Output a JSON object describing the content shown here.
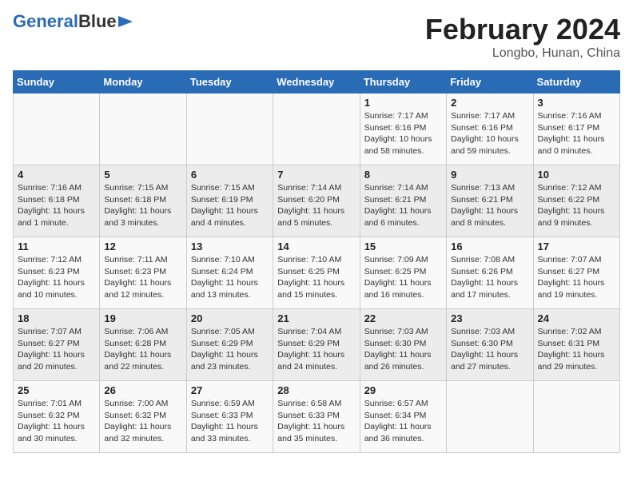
{
  "header": {
    "logo_line1": "General",
    "logo_line2": "Blue",
    "title": "February 2024",
    "subtitle": "Longbo, Hunan, China"
  },
  "days_of_week": [
    "Sunday",
    "Monday",
    "Tuesday",
    "Wednesday",
    "Thursday",
    "Friday",
    "Saturday"
  ],
  "weeks": [
    [
      {
        "day": "",
        "info": ""
      },
      {
        "day": "",
        "info": ""
      },
      {
        "day": "",
        "info": ""
      },
      {
        "day": "",
        "info": ""
      },
      {
        "day": "1",
        "info": "Sunrise: 7:17 AM\nSunset: 6:16 PM\nDaylight: 10 hours\nand 58 minutes."
      },
      {
        "day": "2",
        "info": "Sunrise: 7:17 AM\nSunset: 6:16 PM\nDaylight: 10 hours\nand 59 minutes."
      },
      {
        "day": "3",
        "info": "Sunrise: 7:16 AM\nSunset: 6:17 PM\nDaylight: 11 hours\nand 0 minutes."
      }
    ],
    [
      {
        "day": "4",
        "info": "Sunrise: 7:16 AM\nSunset: 6:18 PM\nDaylight: 11 hours\nand 1 minute."
      },
      {
        "day": "5",
        "info": "Sunrise: 7:15 AM\nSunset: 6:18 PM\nDaylight: 11 hours\nand 3 minutes."
      },
      {
        "day": "6",
        "info": "Sunrise: 7:15 AM\nSunset: 6:19 PM\nDaylight: 11 hours\nand 4 minutes."
      },
      {
        "day": "7",
        "info": "Sunrise: 7:14 AM\nSunset: 6:20 PM\nDaylight: 11 hours\nand 5 minutes."
      },
      {
        "day": "8",
        "info": "Sunrise: 7:14 AM\nSunset: 6:21 PM\nDaylight: 11 hours\nand 6 minutes."
      },
      {
        "day": "9",
        "info": "Sunrise: 7:13 AM\nSunset: 6:21 PM\nDaylight: 11 hours\nand 8 minutes."
      },
      {
        "day": "10",
        "info": "Sunrise: 7:12 AM\nSunset: 6:22 PM\nDaylight: 11 hours\nand 9 minutes."
      }
    ],
    [
      {
        "day": "11",
        "info": "Sunrise: 7:12 AM\nSunset: 6:23 PM\nDaylight: 11 hours\nand 10 minutes."
      },
      {
        "day": "12",
        "info": "Sunrise: 7:11 AM\nSunset: 6:23 PM\nDaylight: 11 hours\nand 12 minutes."
      },
      {
        "day": "13",
        "info": "Sunrise: 7:10 AM\nSunset: 6:24 PM\nDaylight: 11 hours\nand 13 minutes."
      },
      {
        "day": "14",
        "info": "Sunrise: 7:10 AM\nSunset: 6:25 PM\nDaylight: 11 hours\nand 15 minutes."
      },
      {
        "day": "15",
        "info": "Sunrise: 7:09 AM\nSunset: 6:25 PM\nDaylight: 11 hours\nand 16 minutes."
      },
      {
        "day": "16",
        "info": "Sunrise: 7:08 AM\nSunset: 6:26 PM\nDaylight: 11 hours\nand 17 minutes."
      },
      {
        "day": "17",
        "info": "Sunrise: 7:07 AM\nSunset: 6:27 PM\nDaylight: 11 hours\nand 19 minutes."
      }
    ],
    [
      {
        "day": "18",
        "info": "Sunrise: 7:07 AM\nSunset: 6:27 PM\nDaylight: 11 hours\nand 20 minutes."
      },
      {
        "day": "19",
        "info": "Sunrise: 7:06 AM\nSunset: 6:28 PM\nDaylight: 11 hours\nand 22 minutes."
      },
      {
        "day": "20",
        "info": "Sunrise: 7:05 AM\nSunset: 6:29 PM\nDaylight: 11 hours\nand 23 minutes."
      },
      {
        "day": "21",
        "info": "Sunrise: 7:04 AM\nSunset: 6:29 PM\nDaylight: 11 hours\nand 24 minutes."
      },
      {
        "day": "22",
        "info": "Sunrise: 7:03 AM\nSunset: 6:30 PM\nDaylight: 11 hours\nand 26 minutes."
      },
      {
        "day": "23",
        "info": "Sunrise: 7:03 AM\nSunset: 6:30 PM\nDaylight: 11 hours\nand 27 minutes."
      },
      {
        "day": "24",
        "info": "Sunrise: 7:02 AM\nSunset: 6:31 PM\nDaylight: 11 hours\nand 29 minutes."
      }
    ],
    [
      {
        "day": "25",
        "info": "Sunrise: 7:01 AM\nSunset: 6:32 PM\nDaylight: 11 hours\nand 30 minutes."
      },
      {
        "day": "26",
        "info": "Sunrise: 7:00 AM\nSunset: 6:32 PM\nDaylight: 11 hours\nand 32 minutes."
      },
      {
        "day": "27",
        "info": "Sunrise: 6:59 AM\nSunset: 6:33 PM\nDaylight: 11 hours\nand 33 minutes."
      },
      {
        "day": "28",
        "info": "Sunrise: 6:58 AM\nSunset: 6:33 PM\nDaylight: 11 hours\nand 35 minutes."
      },
      {
        "day": "29",
        "info": "Sunrise: 6:57 AM\nSunset: 6:34 PM\nDaylight: 11 hours\nand 36 minutes."
      },
      {
        "day": "",
        "info": ""
      },
      {
        "day": "",
        "info": ""
      }
    ]
  ]
}
